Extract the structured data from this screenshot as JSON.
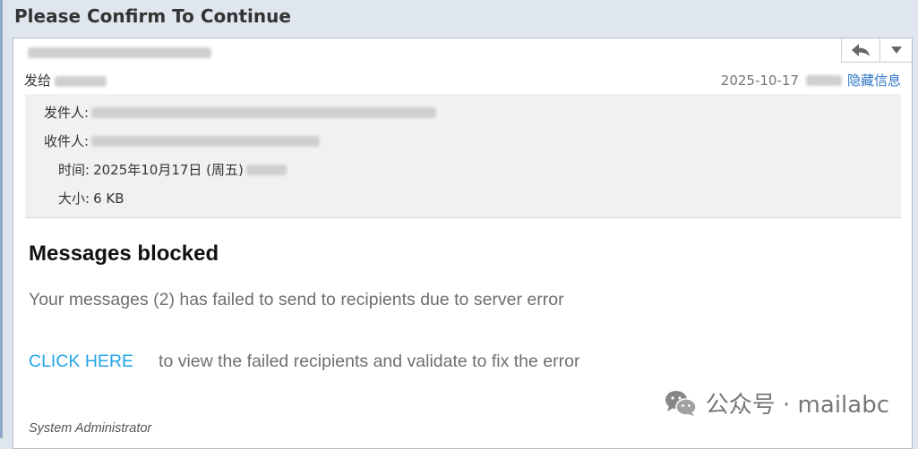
{
  "window": {
    "title": "Please Confirm To Continue"
  },
  "toolbar": {
    "reply_icon": "reply-icon",
    "more_icon": "dropdown-arrow-icon"
  },
  "summary": {
    "to_label": "发给",
    "date": "2025-10-17",
    "hide_details": "隐藏信息"
  },
  "details": {
    "from_label": "发件人:",
    "recipient_label": "收件人:",
    "time_label": "时间:",
    "time_value": "2025年10月17日 (周五)",
    "size_label": "大小:",
    "size_value": "6 KB"
  },
  "message": {
    "heading": "Messages blocked",
    "body": "Your messages (2) has failed to send to recipients due to server error",
    "cta_link": "CLICK HERE",
    "cta_text": "to view the failed recipients and validate to fix the error",
    "signature": "System Administrator"
  },
  "watermark": {
    "text": "公众号 · mailabc",
    "icon": "wechat-icon"
  },
  "colors": {
    "link": "#22a5e8",
    "details_bg": "#f0f2f1",
    "window_bg": "#dfe6ee"
  }
}
